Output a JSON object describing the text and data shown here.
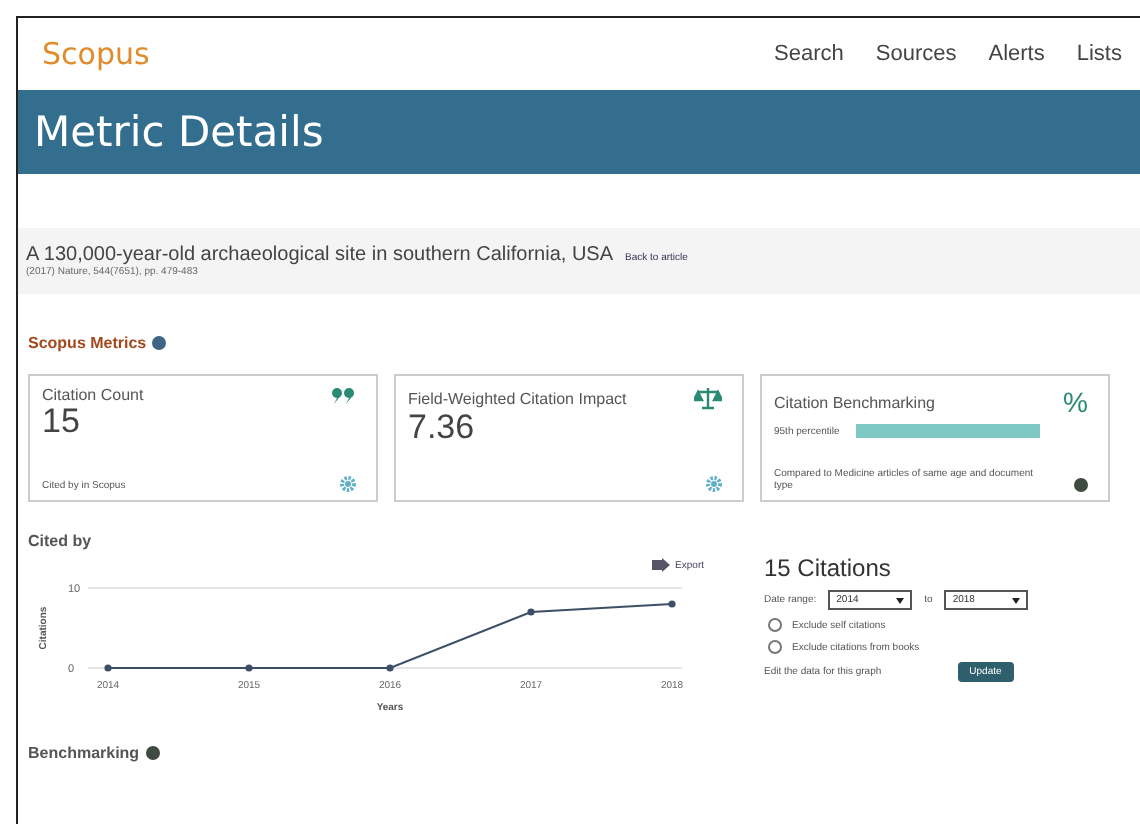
{
  "header": {
    "logo": "Scopus",
    "nav": [
      {
        "label": "Search"
      },
      {
        "label": "Sources"
      },
      {
        "label": "Alerts"
      },
      {
        "label": "Lists"
      }
    ]
  },
  "banner": {
    "title": "Metric Details"
  },
  "article": {
    "title": "A 130,000-year-old archaeological site in southern California, USA",
    "back_link": "Back to article",
    "citation": "(2017) Nature, 544(7651), pp. 479-483"
  },
  "metrics": {
    "heading": "Scopus Metrics",
    "cards": [
      {
        "kind": "count",
        "title": "Citation Count",
        "value": "15",
        "note": "Cited by in Scopus"
      },
      {
        "kind": "fwci",
        "title": "Field-Weighted Citation Impact",
        "value": "7.36"
      },
      {
        "kind": "benchmark",
        "title": "Citation Benchmarking",
        "symbol": "%",
        "percentile": "95th percentile",
        "note": "Compared to Medicine articles of same age and document type"
      }
    ]
  },
  "cited_by": {
    "heading": "Cited by",
    "export": "Export",
    "chart_data": {
      "type": "line",
      "xlabel": "Years",
      "ylabel": "Citations",
      "categories": [
        "2014",
        "2015",
        "2016",
        "2017",
        "2018"
      ],
      "series": [
        {
          "color": "#3d4f66",
          "marker": "circle",
          "values": [
            0,
            0,
            0,
            7,
            8
          ]
        }
      ],
      "yticks": [
        0,
        10
      ],
      "ylim": [
        0,
        10
      ]
    },
    "total": "15  Citations",
    "date_range_label": "Date range:",
    "from": "2014",
    "to_label": "to",
    "to": "2018",
    "options": [
      {
        "label": "Exclude self citations",
        "checked": false
      },
      {
        "label": "Exclude citations from books",
        "checked": false
      }
    ],
    "edit_label": "Edit the data for this graph",
    "update": "Update"
  },
  "benchmarking": {
    "heading": "Benchmarking"
  }
}
